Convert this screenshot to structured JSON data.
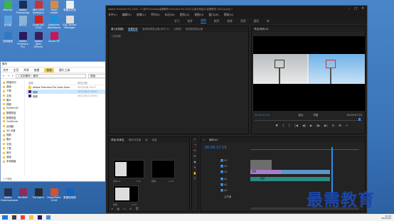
{
  "desktop": {
    "icons": [
      {
        "label": "Wechat"
      },
      {
        "label": "Adobe Photoshop"
      },
      {
        "label": "IBM SPSS Statistics"
      },
      {
        "label": "Epub reader"
      },
      {
        "label": "新建文件夹"
      },
      {
        "label": "此电脑"
      },
      {
        "label": "回收站"
      },
      {
        "label": "AutoCAD 2019"
      },
      {
        "label": "Jetbrains WebStorm"
      },
      {
        "label": "SQL Server Manager"
      },
      {
        "label": "控制面板"
      },
      {
        "label": "Adobe Premiere Pro"
      },
      {
        "label": "Adobe After Effects"
      },
      {
        "label": "Axure RP"
      },
      {
        "label": "Adobe Dreamweaver"
      },
      {
        "label": "WinRAR"
      },
      {
        "label": "PyCharm"
      },
      {
        "label": "PowerPoint 2016"
      },
      {
        "label": "数据蛙视频"
      }
    ],
    "colors": {
      "desktop": "#3a73b8"
    }
  },
  "explorer": {
    "title": "素材",
    "ribbon": [
      "文件",
      "主页",
      "共享",
      "查看",
      "管理",
      "图片工具"
    ],
    "active_ribbon": "管理",
    "path": "« 文本素材 › 素材",
    "search_placeholder": "搜索",
    "nav": [
      "快速访问",
      "桌面",
      "下载",
      "文档",
      "图片",
      "视频",
      "System32",
      "数据恢复",
      "数据恢复",
      "OneDrive",
      "此电脑",
      "3D 对象",
      "视频",
      "图片",
      "文档",
      "下载",
      "音乐",
      "桌面",
      "本地磁盘"
    ],
    "header": [
      "名称",
      "修改日期"
    ],
    "files": [
      {
        "name": "Adobe Premiere Pro Auto-Save",
        "date": "2022/2/8 14:17",
        "selected": false
      },
      {
        "name": "视频",
        "date": "2021/9/13 16:51",
        "selected": true
      },
      {
        "name": "视频",
        "date": "2021/9/13 16:51",
        "selected": false
      }
    ],
    "status": "3 个项目"
  },
  "premiere": {
    "title": "Adobe Premiere Pro 2020 - C:\\用户\\Desktop\\最需教育 Premiere Pro 2020 从新手到高手 最需教育 2022.prproj *",
    "menu": [
      "文件(F)",
      "编辑(E)",
      "剪辑(C)",
      "序列(S)",
      "标记(M)",
      "图形(G)",
      "视图(V)",
      "窗口(W)",
      "帮助(H)"
    ],
    "workspaces": [
      "学习",
      "组件",
      "编辑",
      "颜色",
      "效果",
      "音频",
      "图形",
      "库"
    ],
    "active_workspace": "编辑",
    "source_tabs": [
      "源:(无剪辑)",
      "效果控件",
      "音频剪辑混合器:序列 01",
      "元数据",
      "音频剪辑混合器"
    ],
    "source_empty": "(无剪辑)",
    "program_tab": "节目:序列 01",
    "program_tc_in": "00:00:03:13",
    "program_fit": "适合",
    "program_quality": "完整",
    "program_tc_out": "00:00:07:23",
    "transport": [
      "▼",
      "{",
      "}",
      "|◀",
      "◀|",
      "▶",
      "|▶",
      "▶|",
      "⊡",
      "⊞",
      "+"
    ],
    "project_tabs": [
      "项目:未命名",
      "媒体浏览器",
      "库",
      "信息"
    ],
    "project_items": [
      {
        "name": "序列 01",
        "dur": "7:23"
      },
      {
        "name": "视频",
        "dur": "7:23"
      },
      {
        "name": "视频",
        "dur": "4:23"
      }
    ],
    "tools": [
      "▸",
      "⇢",
      "↔",
      "⇹",
      "◆",
      "✎",
      "✋",
      "T"
    ],
    "timeline_tab": "序列 01",
    "timeline_tc": "00:00:17:19",
    "tracks": [
      "V3",
      "V2",
      "V1",
      "A1",
      "A2",
      "A3",
      "主声道"
    ],
    "clip_v1": "视频",
    "clip_a1": "视频",
    "colors": {
      "accent": "#2d8ceb",
      "clip_video": "#a77ec9",
      "clip_audio": "#2c8a85"
    }
  },
  "taskbar": {
    "time": "14:22",
    "date": "2022/2/8"
  },
  "watermark": "最需教育"
}
